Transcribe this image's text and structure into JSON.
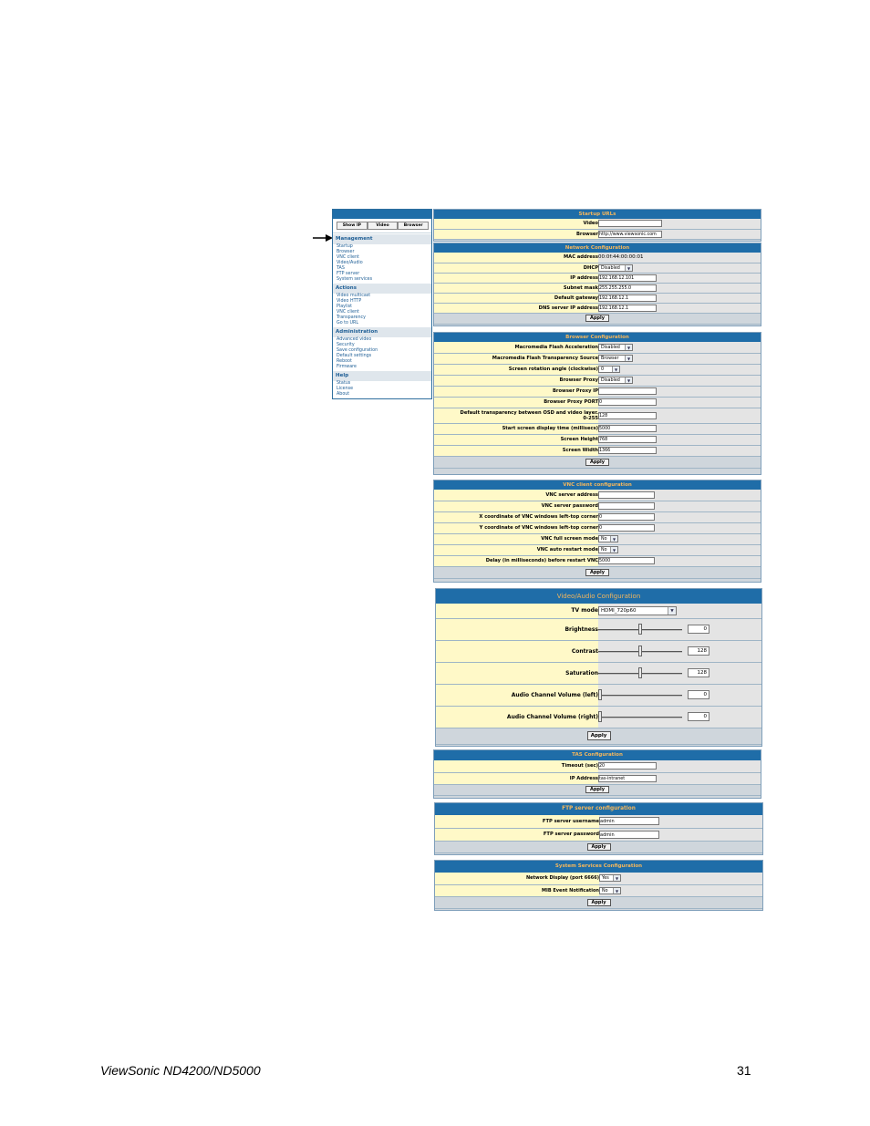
{
  "sidebar": {
    "buttons": [
      "Show IP",
      "Video",
      "Browser"
    ],
    "sections": [
      {
        "title": "Management",
        "items": [
          "Startup",
          "Browser",
          "VNC client",
          "Video/Audio",
          "TAS",
          "FTP server",
          "System services"
        ]
      },
      {
        "title": "Actions",
        "items": [
          "Video multicast",
          "Video HTTP",
          "Playlist",
          "VNC client",
          "Transparency",
          "Go to URL"
        ]
      },
      {
        "title": "Administration",
        "items": [
          "Advanced video",
          "Security",
          "Save configuration",
          "Default settings",
          "Reboot",
          "Firmware"
        ]
      },
      {
        "title": "Help",
        "items": [
          "Status",
          "License",
          "About"
        ]
      }
    ]
  },
  "startup": {
    "title": "Startup URLs",
    "video_label": "Video",
    "video_value": "",
    "browser_label": "Browser",
    "browser_value": "http://www.viewsonic.com"
  },
  "network": {
    "title": "Network Configuration",
    "mac_label": "MAC address",
    "mac_value": "00:0f:44:00:00:01",
    "dhcp_label": "DHCP",
    "dhcp_value": "Disabled",
    "ip_label": "IP address",
    "ip_value": "192.168.12.101",
    "mask_label": "Subnet mask",
    "mask_value": "255.255.255.0",
    "gw_label": "Default gateway",
    "gw_value": "192.168.12.1",
    "dns_label": "DNS server IP address",
    "dns_value": "192.168.12.1",
    "apply": "Apply"
  },
  "browser": {
    "title": "Browser Configuration",
    "accel_label": "Macromedia Flash Acceleration",
    "accel_value": "Disabled",
    "transp_label": "Macromedia Flash Transparency Source",
    "transp_value": "Browser",
    "rot_label": "Screen rotation angle (clockwise)",
    "rot_value": "0",
    "proxy_label": "Browser Proxy",
    "proxy_value": "Disabled",
    "proxyip_label": "Browser Proxy IP",
    "proxyip_value": "",
    "proxyport_label": "Browser Proxy PORT",
    "proxyport_value": "0",
    "osd_label_1": "Default transparency between OSD and video layer.",
    "osd_label_2": "0-255",
    "osd_value": "128",
    "start_label": "Start screen display time (millisecs)",
    "start_value": "5000",
    "height_label": "Screen Height",
    "height_value": "768",
    "width_label": "Screen Width",
    "width_value": "1366",
    "apply": "Apply"
  },
  "vnc": {
    "title": "VNC client configuration",
    "addr_label": "VNC server address",
    "addr_value": "",
    "pass_label": "VNC server password",
    "pass_value": "",
    "x_label": "X coordinate of VNC windows left-top corner",
    "x_value": "0",
    "y_label": "Y coordinate of VNC windows left-top corner",
    "y_value": "0",
    "full_label": "VNC full screen mode",
    "full_value": "No",
    "restart_label": "VNC auto restart mode",
    "restart_value": "No",
    "delay_label": "Delay (in milliseconds) before restart VNC",
    "delay_value": "5000",
    "apply": "Apply"
  },
  "video": {
    "title": "Video/Audio Configuration",
    "tv_label": "TV mode",
    "tv_value": "HDMI_720p60",
    "bright_label": "Brightness",
    "bright_value": "0",
    "bright_level": 0.5,
    "contrast_label": "Contrast",
    "contrast_value": "128",
    "contrast_level": 0.5,
    "sat_label": "Saturation",
    "sat_value": "128",
    "sat_level": 0.5,
    "left_label": "Audio Channel Volume (left)",
    "left_value": "0",
    "left_level": 0,
    "right_label": "Audio Channel Volume (right)",
    "right_value": "0",
    "right_level": 0,
    "apply": "Apply"
  },
  "tas": {
    "title": "TAS Configuration",
    "timeout_label": "Timeout (sec)",
    "timeout_value": "20",
    "ip_label": "IP Address",
    "ip_value": "tas-intranet",
    "apply": "Apply"
  },
  "ftp": {
    "title": "FTP server configuration",
    "user_label": "FTP server username",
    "user_value": "admin",
    "pass_label": "FTP server password",
    "pass_value": "admin",
    "apply": "Apply"
  },
  "services": {
    "title": "System Services Configuration",
    "nd_label": "Network Display (port 6666)",
    "nd_value": "Yes",
    "mib_label": "MIB Event Notification",
    "mib_value": "No",
    "apply": "Apply"
  },
  "footer": {
    "product": "ViewSonic ND4200/ND5000",
    "page": "31"
  },
  "colors": {
    "header": "#1f6da8",
    "header_text": "#f5b75c",
    "label_bg": "#fff9c8",
    "value_bg": "#e4e4e4"
  }
}
